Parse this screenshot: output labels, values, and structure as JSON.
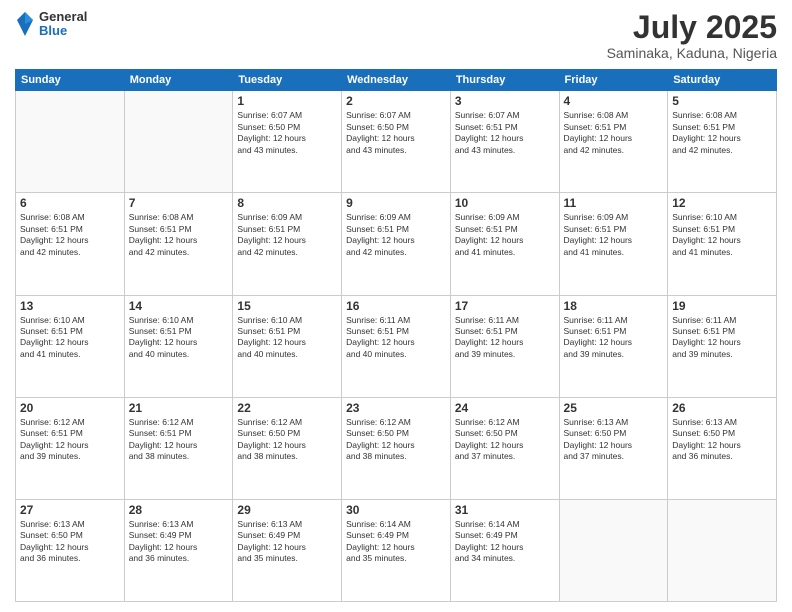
{
  "header": {
    "logo": {
      "general": "General",
      "blue": "Blue"
    },
    "title": "July 2025",
    "location": "Saminaka, Kaduna, Nigeria"
  },
  "days_of_week": [
    "Sunday",
    "Monday",
    "Tuesday",
    "Wednesday",
    "Thursday",
    "Friday",
    "Saturday"
  ],
  "weeks": [
    [
      {
        "day": "",
        "info": ""
      },
      {
        "day": "",
        "info": ""
      },
      {
        "day": "1",
        "info": "Sunrise: 6:07 AM\nSunset: 6:50 PM\nDaylight: 12 hours\nand 43 minutes."
      },
      {
        "day": "2",
        "info": "Sunrise: 6:07 AM\nSunset: 6:50 PM\nDaylight: 12 hours\nand 43 minutes."
      },
      {
        "day": "3",
        "info": "Sunrise: 6:07 AM\nSunset: 6:51 PM\nDaylight: 12 hours\nand 43 minutes."
      },
      {
        "day": "4",
        "info": "Sunrise: 6:08 AM\nSunset: 6:51 PM\nDaylight: 12 hours\nand 42 minutes."
      },
      {
        "day": "5",
        "info": "Sunrise: 6:08 AM\nSunset: 6:51 PM\nDaylight: 12 hours\nand 42 minutes."
      }
    ],
    [
      {
        "day": "6",
        "info": "Sunrise: 6:08 AM\nSunset: 6:51 PM\nDaylight: 12 hours\nand 42 minutes."
      },
      {
        "day": "7",
        "info": "Sunrise: 6:08 AM\nSunset: 6:51 PM\nDaylight: 12 hours\nand 42 minutes."
      },
      {
        "day": "8",
        "info": "Sunrise: 6:09 AM\nSunset: 6:51 PM\nDaylight: 12 hours\nand 42 minutes."
      },
      {
        "day": "9",
        "info": "Sunrise: 6:09 AM\nSunset: 6:51 PM\nDaylight: 12 hours\nand 42 minutes."
      },
      {
        "day": "10",
        "info": "Sunrise: 6:09 AM\nSunset: 6:51 PM\nDaylight: 12 hours\nand 41 minutes."
      },
      {
        "day": "11",
        "info": "Sunrise: 6:09 AM\nSunset: 6:51 PM\nDaylight: 12 hours\nand 41 minutes."
      },
      {
        "day": "12",
        "info": "Sunrise: 6:10 AM\nSunset: 6:51 PM\nDaylight: 12 hours\nand 41 minutes."
      }
    ],
    [
      {
        "day": "13",
        "info": "Sunrise: 6:10 AM\nSunset: 6:51 PM\nDaylight: 12 hours\nand 41 minutes."
      },
      {
        "day": "14",
        "info": "Sunrise: 6:10 AM\nSunset: 6:51 PM\nDaylight: 12 hours\nand 40 minutes."
      },
      {
        "day": "15",
        "info": "Sunrise: 6:10 AM\nSunset: 6:51 PM\nDaylight: 12 hours\nand 40 minutes."
      },
      {
        "day": "16",
        "info": "Sunrise: 6:11 AM\nSunset: 6:51 PM\nDaylight: 12 hours\nand 40 minutes."
      },
      {
        "day": "17",
        "info": "Sunrise: 6:11 AM\nSunset: 6:51 PM\nDaylight: 12 hours\nand 39 minutes."
      },
      {
        "day": "18",
        "info": "Sunrise: 6:11 AM\nSunset: 6:51 PM\nDaylight: 12 hours\nand 39 minutes."
      },
      {
        "day": "19",
        "info": "Sunrise: 6:11 AM\nSunset: 6:51 PM\nDaylight: 12 hours\nand 39 minutes."
      }
    ],
    [
      {
        "day": "20",
        "info": "Sunrise: 6:12 AM\nSunset: 6:51 PM\nDaylight: 12 hours\nand 39 minutes."
      },
      {
        "day": "21",
        "info": "Sunrise: 6:12 AM\nSunset: 6:51 PM\nDaylight: 12 hours\nand 38 minutes."
      },
      {
        "day": "22",
        "info": "Sunrise: 6:12 AM\nSunset: 6:50 PM\nDaylight: 12 hours\nand 38 minutes."
      },
      {
        "day": "23",
        "info": "Sunrise: 6:12 AM\nSunset: 6:50 PM\nDaylight: 12 hours\nand 38 minutes."
      },
      {
        "day": "24",
        "info": "Sunrise: 6:12 AM\nSunset: 6:50 PM\nDaylight: 12 hours\nand 37 minutes."
      },
      {
        "day": "25",
        "info": "Sunrise: 6:13 AM\nSunset: 6:50 PM\nDaylight: 12 hours\nand 37 minutes."
      },
      {
        "day": "26",
        "info": "Sunrise: 6:13 AM\nSunset: 6:50 PM\nDaylight: 12 hours\nand 36 minutes."
      }
    ],
    [
      {
        "day": "27",
        "info": "Sunrise: 6:13 AM\nSunset: 6:50 PM\nDaylight: 12 hours\nand 36 minutes."
      },
      {
        "day": "28",
        "info": "Sunrise: 6:13 AM\nSunset: 6:49 PM\nDaylight: 12 hours\nand 36 minutes."
      },
      {
        "day": "29",
        "info": "Sunrise: 6:13 AM\nSunset: 6:49 PM\nDaylight: 12 hours\nand 35 minutes."
      },
      {
        "day": "30",
        "info": "Sunrise: 6:14 AM\nSunset: 6:49 PM\nDaylight: 12 hours\nand 35 minutes."
      },
      {
        "day": "31",
        "info": "Sunrise: 6:14 AM\nSunset: 6:49 PM\nDaylight: 12 hours\nand 34 minutes."
      },
      {
        "day": "",
        "info": ""
      },
      {
        "day": "",
        "info": ""
      }
    ]
  ]
}
